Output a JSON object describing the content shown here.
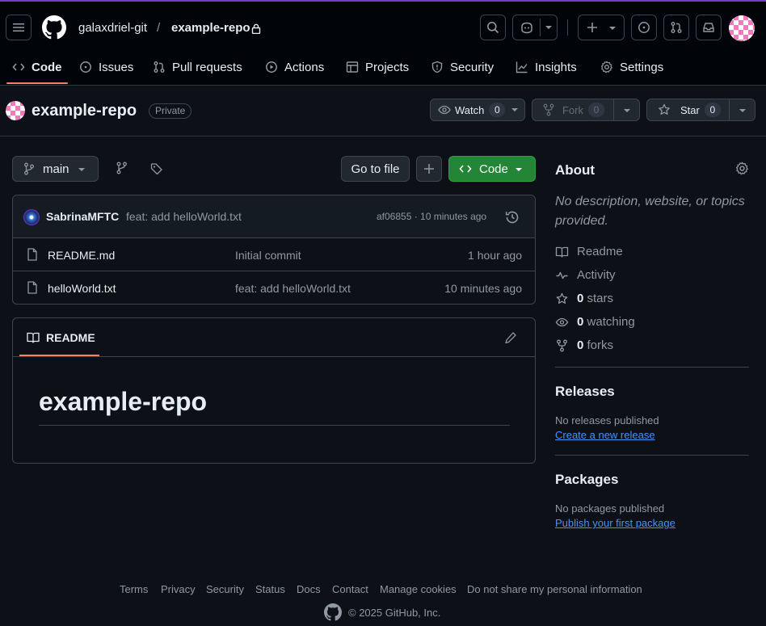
{
  "header": {
    "owner": "galaxdriel-git",
    "separator": "/",
    "repo": "example-repo"
  },
  "nav": {
    "tabs": [
      {
        "label": "Code"
      },
      {
        "label": "Issues"
      },
      {
        "label": "Pull requests"
      },
      {
        "label": "Actions"
      },
      {
        "label": "Projects"
      },
      {
        "label": "Security"
      },
      {
        "label": "Insights"
      },
      {
        "label": "Settings"
      }
    ]
  },
  "repo_header": {
    "name": "example-repo",
    "visibility": "Private",
    "watch_label": "Watch",
    "watch_count": "0",
    "fork_label": "Fork",
    "fork_count": "0",
    "star_label": "Star",
    "star_count": "0"
  },
  "toolbar": {
    "branch": "main",
    "go_to_file": "Go to file",
    "code_label": "Code"
  },
  "commit": {
    "author": "SabrinaMFTC",
    "message": "feat: add helloWorld.txt",
    "meta": "af06855 · 10 minutes ago"
  },
  "files": [
    {
      "name": "README.md",
      "message": "Initial commit",
      "time": "1 hour ago"
    },
    {
      "name": "helloWorld.txt",
      "message": "feat: add helloWorld.txt",
      "time": "10 minutes ago"
    }
  ],
  "readme": {
    "tab_label": "README",
    "heading": "example-repo"
  },
  "about": {
    "title": "About",
    "description": "No description, website, or topics provided.",
    "links": {
      "readme": "Readme",
      "activity": "Activity",
      "stars_count": "0",
      "stars_label": "stars",
      "watching_count": "0",
      "watching_label": "watching",
      "forks_count": "0",
      "forks_label": "forks"
    }
  },
  "releases": {
    "title": "Releases",
    "empty": "No releases published",
    "link": "Create a new release"
  },
  "packages": {
    "title": "Packages",
    "empty": "No packages published",
    "link": "Publish your first package"
  },
  "footer": {
    "links": [
      "Terms",
      "Privacy",
      "Security",
      "Status",
      "Docs",
      "Contact",
      "Manage cookies",
      "Do not share my personal information"
    ],
    "copyright": "© 2025 GitHub, Inc."
  },
  "colors": {
    "accent_green": "#238636",
    "underline": "#f78166",
    "link_blue": "#4493f8",
    "background": "#0d1117"
  }
}
